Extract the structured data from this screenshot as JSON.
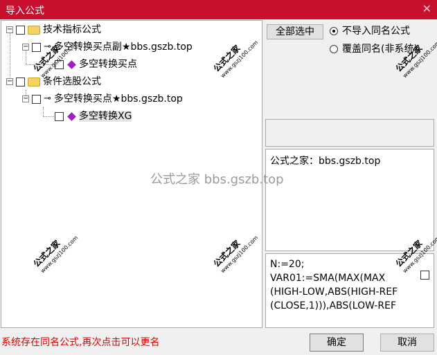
{
  "window": {
    "title": "导入公式",
    "close_glyph": "✕"
  },
  "tree": {
    "group1": {
      "label": "技术指标公式"
    },
    "item1": {
      "label": "多空转换买点副★bbs.gszb.top"
    },
    "item1_child": {
      "label": "多空转换买点"
    },
    "group2": {
      "label": "条件选股公式"
    },
    "item2": {
      "label": "多空转换买点★bbs.gszb.top"
    },
    "item2_child": {
      "label": "多空转换XG"
    }
  },
  "options": {
    "select_all_label": "全部选中",
    "radio_no_import": "不导入同名公式",
    "radio_overwrite": "覆盖同名(非系统)",
    "selected": "radio_no_import"
  },
  "info": {
    "text": "公式之家：bbs.gszb.top"
  },
  "code": {
    "lines": "N:=20;\nVAR01:=SMA(MAX(MAX\n(HIGH-LOW,ABS(HIGH-REF\n(CLOSE,1))),ABS(LOW-REF"
  },
  "watermarks": {
    "center_text": "公式之家 bbs.gszb.top",
    "stamp_big": "公式之家",
    "stamp_small": "www.gszj100.com"
  },
  "status": {
    "message": "系统存在同名公式,再次点击可以更名"
  },
  "buttons": {
    "ok": "确定",
    "cancel": "取消"
  },
  "colors": {
    "titlebar": "#c8102e",
    "status_text": "#e00000",
    "gem": "#a01fbf"
  },
  "icons": {
    "folder": "folder-icon",
    "key": "key-icon",
    "gem": "formula-gem-icon"
  }
}
